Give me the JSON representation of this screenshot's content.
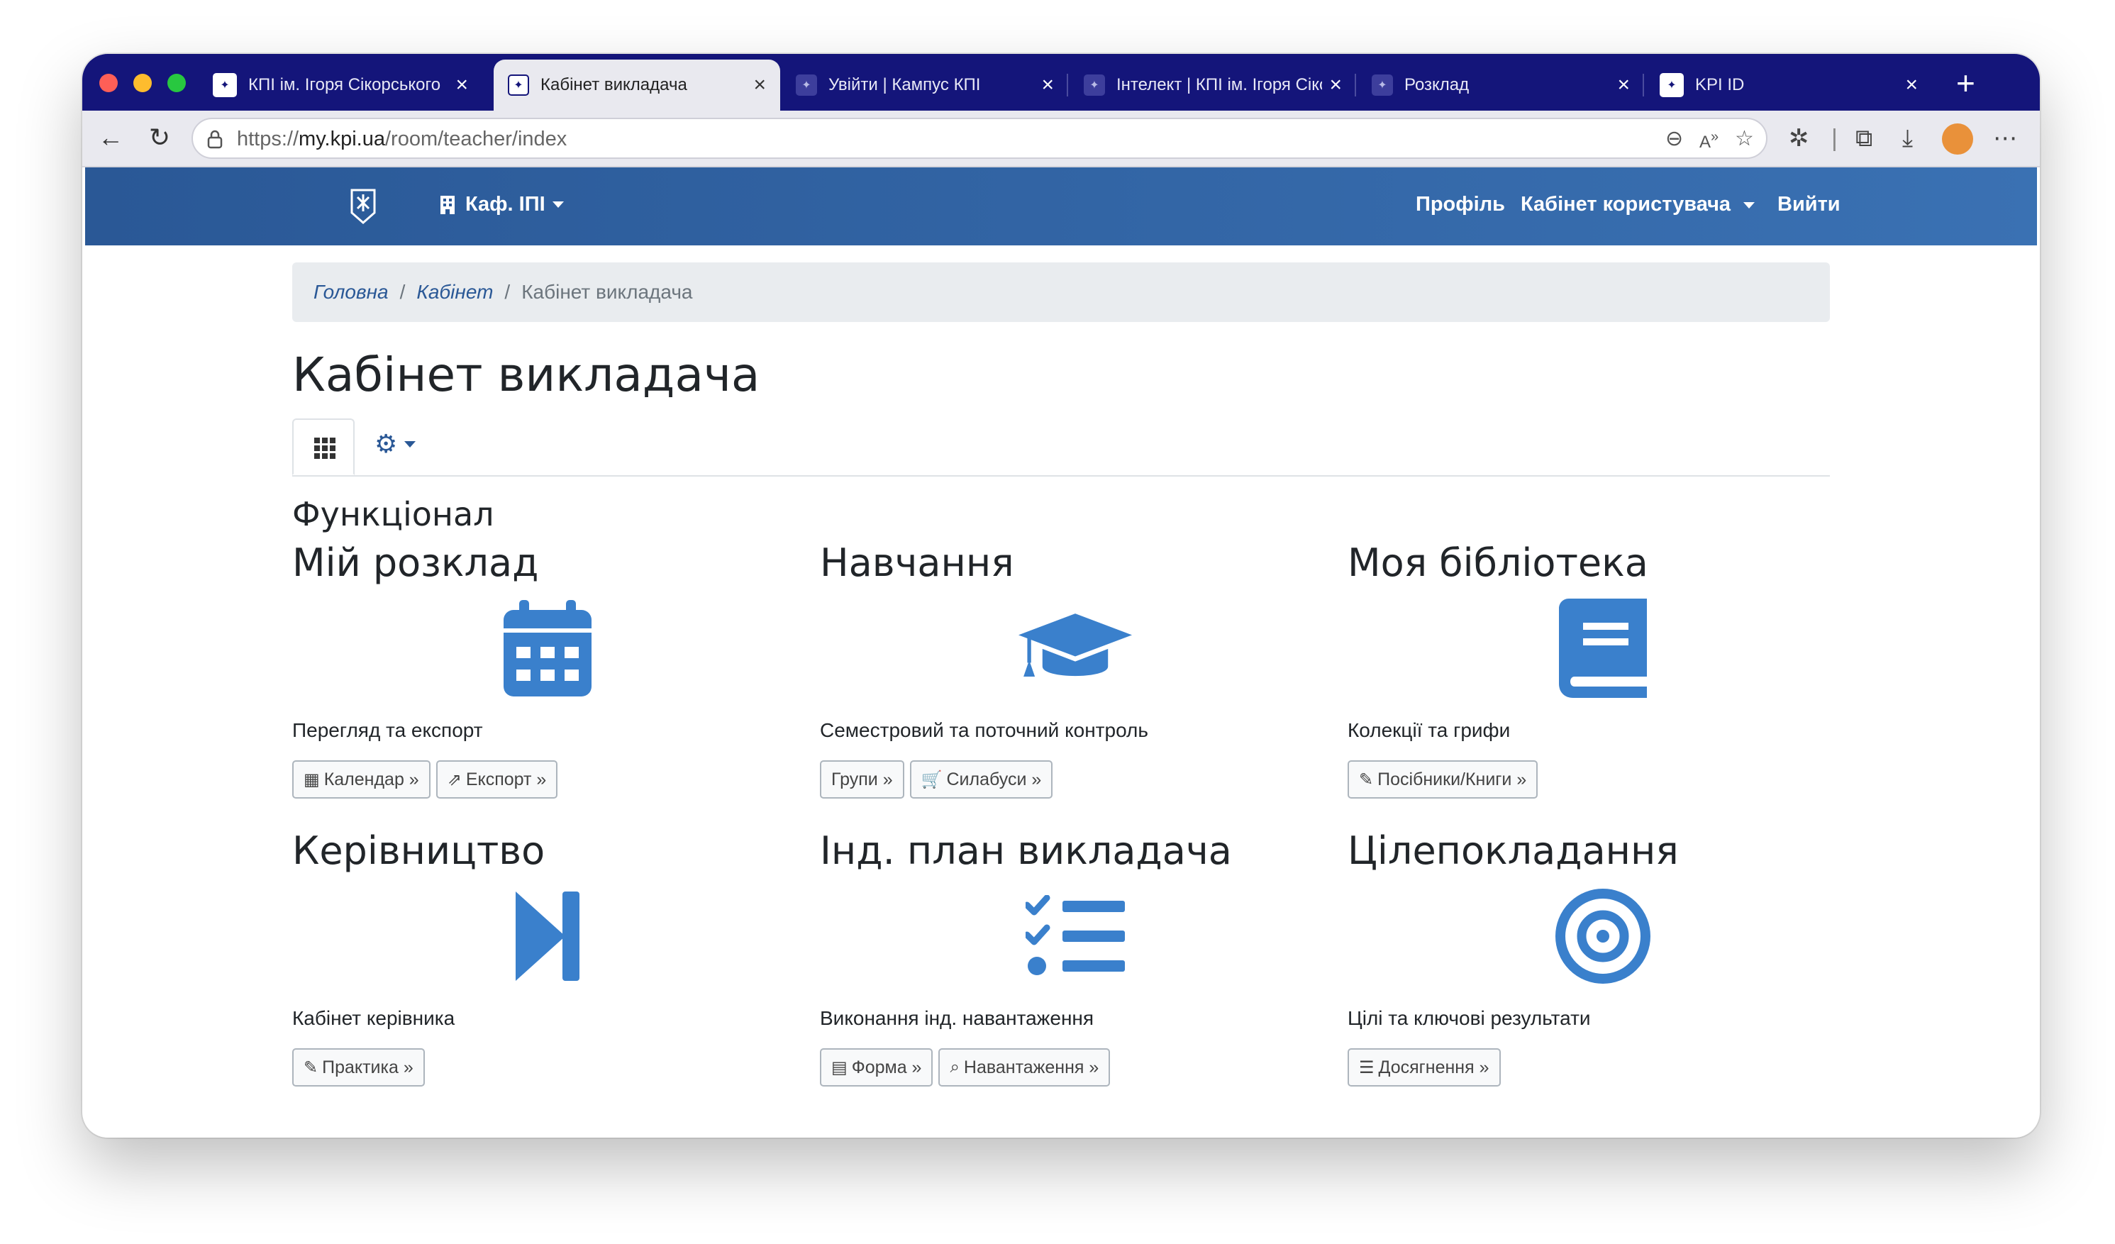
{
  "browser": {
    "tabs": [
      {
        "title": "КПІ ім. Ігоря Сікорського",
        "active": false
      },
      {
        "title": "Кабінет викладача",
        "active": true
      },
      {
        "title": "Увійти | Кампус КПІ",
        "active": false
      },
      {
        "title": "Інтелект | КПІ ім. Ігоря Сікорського",
        "active": false
      },
      {
        "title": "Розклад",
        "active": false
      },
      {
        "title": "KPI ID",
        "active": false
      }
    ],
    "url_scheme": "https://",
    "url_host": "my.kpi.ua",
    "url_path": "/room/teacher/index"
  },
  "navbar": {
    "department": "Каф. ІПІ",
    "profile": "Профіль",
    "user_cabinet": "Кабінет користувача",
    "logout": "Вийти"
  },
  "breadcrumb": {
    "home": "Головна",
    "cabinet": "Кабінет",
    "current": "Кабінет викладача"
  },
  "page": {
    "title": "Кабінет викладача",
    "section_title": "Функціонал"
  },
  "cards": [
    {
      "title": "Мій розклад",
      "icon": "calendar-icon",
      "desc": "Перегляд та експорт",
      "buttons": [
        "Календар »",
        "Експорт »"
      ]
    },
    {
      "title": "Навчання",
      "icon": "graduation-cap-icon",
      "desc": "Семестровий та поточний контроль",
      "buttons": [
        "Групи »",
        "Силабуси »"
      ]
    },
    {
      "title": "Моя бібліотека",
      "icon": "book-icon",
      "desc": "Колекції та грифи",
      "buttons": [
        "Посібники/Книги »"
      ]
    },
    {
      "title": "Керівництво",
      "icon": "step-forward-icon",
      "desc": "Кабінет керівника",
      "buttons": [
        "Практика »"
      ]
    },
    {
      "title": "Інд. план викладача",
      "icon": "task-list-icon",
      "desc": "Виконання інд. навантаження",
      "buttons": [
        "Форма »",
        "Навантаження »"
      ]
    },
    {
      "title": "Цілепокладання",
      "icon": "target-icon",
      "desc": "Цілі та ключові результати",
      "buttons": [
        "Досягнення »"
      ]
    }
  ],
  "colors": {
    "tab_strip": "#14157a",
    "navbar_start": "#2a5896",
    "navbar_end": "#3a71b3",
    "icon_blue": "#3a80cc",
    "link": "#2a5896"
  }
}
